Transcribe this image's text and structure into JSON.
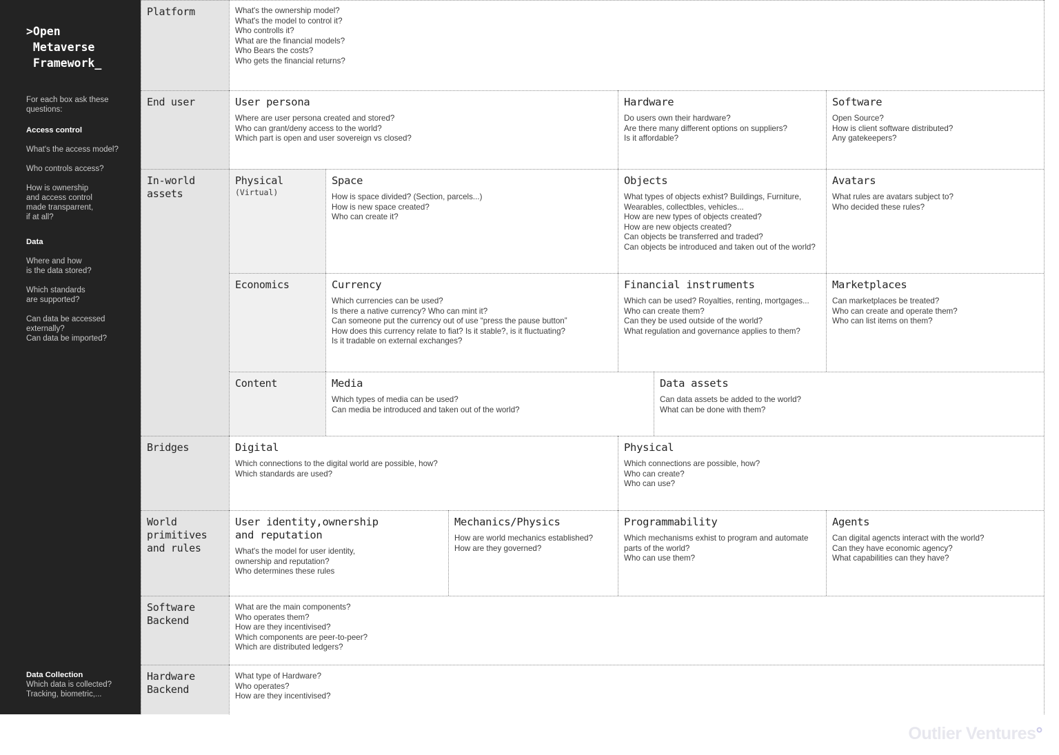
{
  "sidebar": {
    "brand": ">Open\n Metaverse\n Framework_",
    "intro": "For each box ask these questions:",
    "sections": [
      {
        "heading": "Access control",
        "questions": [
          "What's the access model?",
          "Who controls access?",
          "How is ownership\nand access control\nmade transparrent,\nif at all?"
        ]
      },
      {
        "heading": "Data",
        "questions": [
          "Where and how\nis the data stored?",
          "Which standards\nare supported?",
          "Can data be accessed\nexternally?\nCan data be imported?"
        ]
      }
    ],
    "footer": {
      "heading": "Data Collection",
      "questions": "Which data is collected?\nTracking, biometric,..."
    }
  },
  "footer": {
    "logo_text": "Outlier Ventures",
    "logo_dot": "°"
  },
  "rows": {
    "platform": {
      "label": "Platform",
      "questions": [
        "What's the ownership model?",
        "What's the model to control it?",
        "Who controlls it?",
        "What are the financial models?",
        "Who Bears the costs?",
        "Who gets the financial returns?"
      ]
    },
    "enduser": {
      "label": "End user",
      "user_persona": {
        "title": "User persona",
        "questions": [
          "Where are user persona created and stored?",
          "Who can grant/deny access to the world?",
          "Which part is open and user sovereign vs closed?"
        ]
      },
      "hardware": {
        "title": "Hardware",
        "questions": [
          "Do users own their hardware?",
          "Are there many different options on suppliers?",
          "Is it affordable?"
        ]
      },
      "software": {
        "title": "Software",
        "questions": [
          "Open Source?",
          "How is client software distributed?",
          "Any gatekeepers?"
        ]
      }
    },
    "inworld": {
      "label": "In-world\nassets",
      "physical": {
        "title": "Physical",
        "subtitle": "(Virtual)"
      },
      "space": {
        "title": "Space",
        "questions": [
          "How is space divided? (Section, parcels...)",
          "How is new space created?",
          "Who can create it?"
        ]
      },
      "objects": {
        "title": "Objects",
        "questions": [
          "What types of objects exhist? Buildings, Furniture,",
          "Wearables, collectbles, vehicles...",
          "How are new types of objects created?",
          "How are new objects created?",
          "Can objects be transferred and traded?",
          "Can objects be introduced and taken out of the world?"
        ]
      },
      "avatars": {
        "title": "Avatars",
        "questions": [
          "What rules are avatars subject to?",
          "Who decided these rules?"
        ]
      },
      "economics": {
        "title": "Economics"
      },
      "currency": {
        "title": "Currency",
        "questions": [
          "Which currencies can be used?",
          "Is there a native currency? Who can mint it?",
          "Can someone put the currency out of use “press the pause button”",
          "How does this currency relate to fiat? Is it stable?, is it fluctuating?",
          "Is it tradable on external exchanges?"
        ]
      },
      "financial_instruments": {
        "title": "Financial instruments",
        "questions": [
          "Which can be used? Royalties, renting, mortgages...",
          "Who can create them?",
          "Can they be used outside of the world?",
          "What regulation and governance applies to them?"
        ]
      },
      "marketplaces": {
        "title": "Marketplaces",
        "questions": [
          "Can marketplaces be treated?",
          "Who can create and operate them?",
          "Who can list items on them?"
        ]
      },
      "content": {
        "title": "Content"
      },
      "media": {
        "title": "Media",
        "questions": [
          "Which types of media can be used?",
          "Can media be introduced and taken out of the world?"
        ]
      },
      "data_assets": {
        "title": "Data assets",
        "questions": [
          "Can data assets be added to the world?",
          "What can be done with them?"
        ]
      }
    },
    "bridges": {
      "label": "Bridges",
      "digital": {
        "title": "Digital",
        "questions": [
          "Which connections to the digital world are possible, how?",
          "Which standards are used?"
        ]
      },
      "physical": {
        "title": "Physical",
        "questions": [
          "Which connections are possible, how?",
          "Who can create?",
          "Who can use?"
        ]
      }
    },
    "primitives": {
      "label": "World\nprimitives\nand rules",
      "identity": {
        "title": "User identity,ownership\nand reputation",
        "questions": [
          "What's the model for user identity,",
          "ownership and reputation?",
          "Who determines these rules"
        ]
      },
      "mechanics": {
        "title": "Mechanics/Physics",
        "questions": [
          "How are world mechanics established?",
          "How are they governed?"
        ]
      },
      "programmability": {
        "title": "Programmability",
        "questions": [
          "Which mechanisms exhist to program and automate",
          "parts of the world?",
          "Who can use them?"
        ]
      },
      "agents": {
        "title": "Agents",
        "questions": [
          "Can digital agencts interact with the world?",
          "Can they have economic agency?",
          "What capabilities can they have?"
        ]
      }
    },
    "software_backend": {
      "label": "Software\nBackend",
      "questions": [
        "What are the main components?",
        "Who operates them?",
        "How are they incentivised?",
        "Which components are peer-to-peer?",
        "Which are distributed ledgers?"
      ]
    },
    "hardware_backend": {
      "label": "Hardware\nBackend",
      "questions": [
        "What type of Hardware?",
        "Who operates?",
        "How are they incentivised?"
      ]
    }
  }
}
